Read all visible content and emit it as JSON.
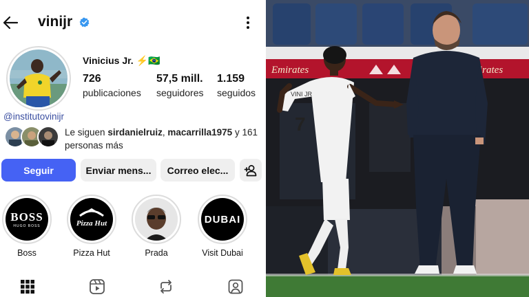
{
  "profile": {
    "username": "vinijr",
    "display_name": "Vinicius Jr. ⚡🇧🇷",
    "stats": [
      {
        "value": "726",
        "label": "publicaciones"
      },
      {
        "value": "57,5 mill.",
        "label": "seguidores"
      },
      {
        "value": "1.159",
        "label": "seguidos"
      }
    ],
    "bio_link": "@institutovinijr",
    "followed_by": {
      "prefix": "Le siguen ",
      "user1": "sirdanielruiz",
      "sep": ", ",
      "user2": "macarrilla1975",
      "suffix": " y 161 personas más"
    }
  },
  "actions": {
    "follow": "Seguir",
    "message": "Enviar mens...",
    "email": "Correo elec..."
  },
  "highlights": [
    {
      "name": "Boss",
      "badge_main": "BOSS",
      "badge_sub": "HUGO BOSS"
    },
    {
      "name": "Pizza Hut",
      "badge_main": "Pizza Hut"
    },
    {
      "name": "Prada"
    },
    {
      "name": "Visit Dubai",
      "badge_main": "DUBAI"
    }
  ],
  "photo": {
    "board_text": "Emirates",
    "board_text_2": "irates",
    "jersey_name": "VINI JR",
    "jersey_number": "7"
  },
  "colors": {
    "accent": "#4562f4",
    "link": "#3a4ea0",
    "verified": "#3897f0",
    "board_red": "#b3142c"
  },
  "icons": [
    "back-arrow-icon",
    "verified-badge-icon",
    "more-vertical-icon",
    "add-person-icon",
    "grid-icon",
    "reels-icon",
    "reposts-icon",
    "tagged-icon"
  ]
}
